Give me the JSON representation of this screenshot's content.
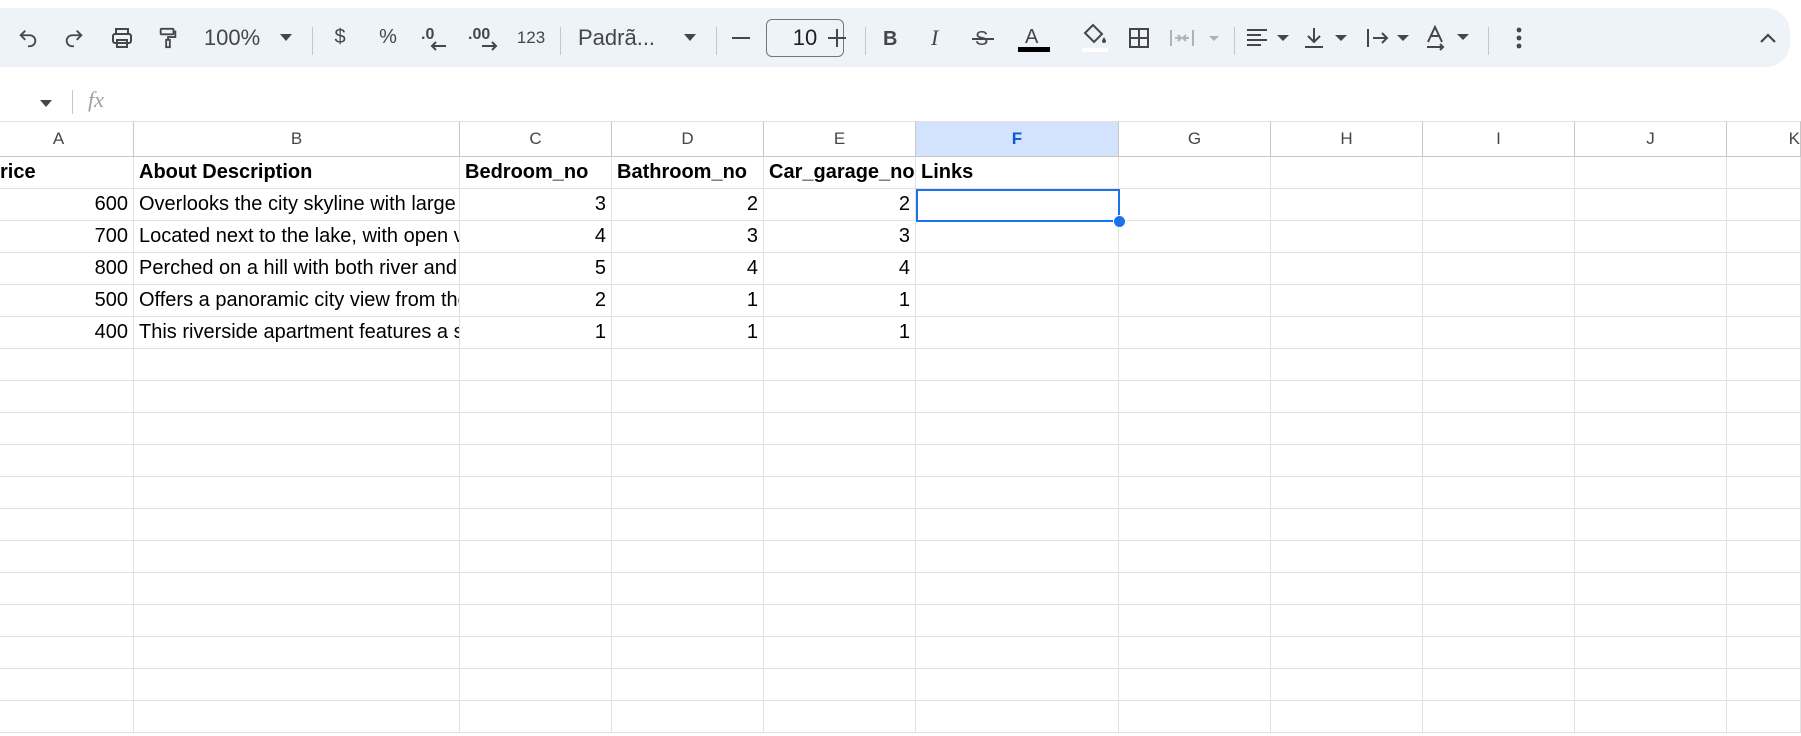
{
  "toolbar": {
    "zoom": "100%",
    "currency_symbol": "$",
    "percent_symbol": "%",
    "decrease_decimals": ".0",
    "increase_decimals": ".00",
    "number_format": "123",
    "font_name": "Padrã...",
    "font_size": "10",
    "text_color": "#000000",
    "icons": [
      "undo-icon",
      "redo-icon",
      "print-icon",
      "paint-format-icon",
      "minus-icon",
      "plus-icon",
      "bold-icon",
      "italic-icon",
      "strikethrough-icon",
      "text-color-icon",
      "fill-color-icon",
      "borders-icon",
      "merge-cells-icon",
      "horizontal-align-icon",
      "vertical-align-icon",
      "text-wrap-icon",
      "text-rotation-icon",
      "more-icon",
      "collapse-icon"
    ]
  },
  "formula_bar": {
    "fx_label": "fx",
    "value": ""
  },
  "columns": [
    "A",
    "B",
    "C",
    "D",
    "E",
    "F",
    "G",
    "H",
    "I",
    "J",
    "K"
  ],
  "selected_column": "F",
  "header_row": [
    "rice",
    "About Description",
    "Bedroom_no",
    "Bathroom_no",
    "Car_garage_no",
    "Links"
  ],
  "rows": [
    [
      "600",
      "Overlooks the city skyline with large windows and a spacious balcony",
      "3",
      "2",
      "2",
      ""
    ],
    [
      "700",
      "Located next to the lake, with open views from the living room",
      "4",
      "3",
      "3",
      ""
    ],
    [
      "800",
      "Perched on a hill with both river and city views",
      "5",
      "4",
      "4",
      ""
    ],
    [
      "500",
      "Offers a panoramic city view from the top floor",
      "2",
      "1",
      "1",
      ""
    ],
    [
      "400",
      "This riverside apartment features a small garden",
      "1",
      "1",
      "1",
      ""
    ]
  ],
  "selected_cell": "F2",
  "colors": {
    "accent": "#1a73e8",
    "toolbar_bg": "#eef2f9",
    "selected_header_bg": "#d3e3fd"
  }
}
